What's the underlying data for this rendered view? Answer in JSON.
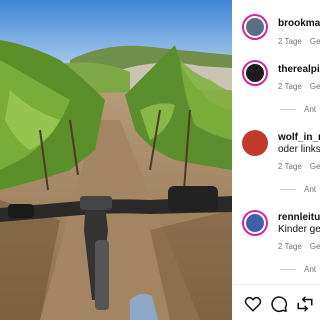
{
  "comments": [
    {
      "username": "brookmac",
      "text": "",
      "time": "2 Tage",
      "reply_label": "Ge"
    },
    {
      "username": "therealpil",
      "text": "",
      "time": "2 Tage",
      "reply_label": "Ge"
    },
    {
      "username": "wolf_in_m",
      "text": "oder links",
      "time": "2 Tage",
      "reply_label": "Ge"
    },
    {
      "username": "rennleitur",
      "text": "Kinder ge",
      "time": "2 Tage",
      "reply_label": "Ge"
    }
  ],
  "view_replies": [
    "Ant",
    "Ant",
    "Ant"
  ],
  "actions": {
    "like_icon": "heart-icon",
    "comment_icon": "comment-icon",
    "share_icon": "share-icon"
  },
  "colors": {
    "story_ring": "#d6249f",
    "muted_text": "#737373"
  }
}
